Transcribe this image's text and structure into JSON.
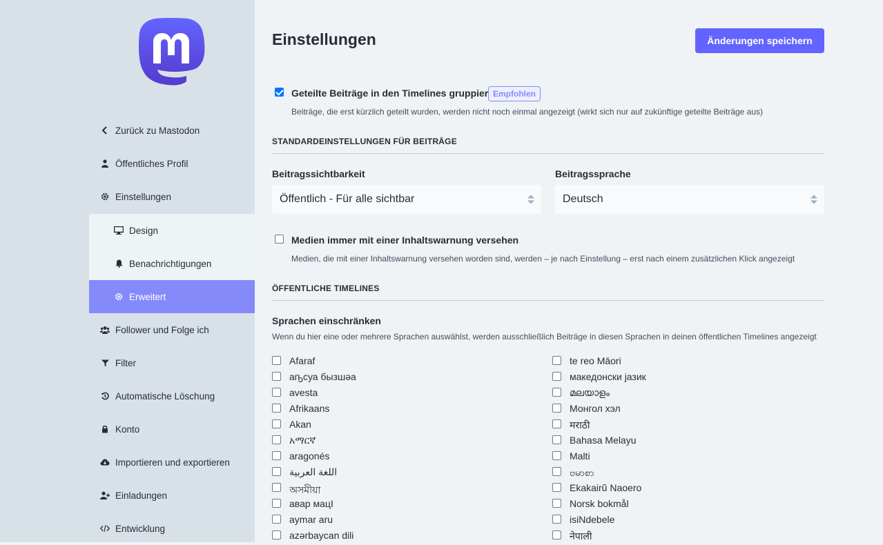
{
  "sidebar": {
    "logo": "mastodon-logo",
    "items": [
      {
        "label": "Zurück zu Mastodon",
        "icon": "chevron-left-icon"
      },
      {
        "label": "Öffentliches Profil",
        "icon": "user-icon"
      },
      {
        "label": "Einstellungen",
        "icon": "gear-icon"
      },
      {
        "label": "Design",
        "icon": "desktop-icon"
      },
      {
        "label": "Benachrichtigungen",
        "icon": "bell-icon"
      },
      {
        "label": "Erweitert",
        "icon": "gear-icon"
      },
      {
        "label": "Follower und Folge ich",
        "icon": "users-icon"
      },
      {
        "label": "Filter",
        "icon": "filter-icon"
      },
      {
        "label": "Automatische Löschung",
        "icon": "history-icon"
      },
      {
        "label": "Konto",
        "icon": "lock-icon"
      },
      {
        "label": "Importieren und exportieren",
        "icon": "cloud-download-icon"
      },
      {
        "label": "Einladungen",
        "icon": "user-plus-icon"
      },
      {
        "label": "Entwicklung",
        "icon": "code-icon"
      }
    ]
  },
  "header": {
    "title": "Einstellungen",
    "save_label": "Änderungen speichern"
  },
  "colors": {
    "accent": "#6364ff",
    "active_nav": "#858afa",
    "sidebar": "#d9e1e8",
    "main": "#eff3f5"
  },
  "group_reblogs": {
    "checked": true,
    "label": "Geteilte Beiträge in den Timelines gruppieren",
    "badge": "Empfohlen",
    "hint": "Beiträge, die erst kürzlich geteilt wurden, werden nicht noch einmal angezeigt (wirkt sich nur auf zukünftige geteilte Beiträge aus)"
  },
  "posting_defaults": {
    "section_title": "STANDARDEINSTELLUNGEN FÜR BEITRÄGE",
    "visibility_label": "Beitragssichtbarkeit",
    "visibility_value": "Öffentlich - Für alle sichtbar",
    "language_label": "Beitragssprache",
    "language_value": "Deutsch"
  },
  "sensitive": {
    "checked": false,
    "label": "Medien immer mit einer Inhaltswarnung versehen",
    "hint": "Medien, die mit einer Inhaltswarnung versehen worden sind, werden – je nach Einstellung – erst nach einem zusätzlichen Klick angezeigt"
  },
  "public_timelines": {
    "section_title": "ÖFFENTLICHE TIMELINES",
    "languages_label": "Sprachen einschränken",
    "languages_hint": "Wenn du hier eine oder mehrere Sprachen auswählst, werden ausschließlich Beiträge in diesen Sprachen in deinen öffentlichen Timelines angezeigt",
    "languages_left": [
      "Afaraf",
      "аҧсуа бызшәа",
      "avesta",
      "Afrikaans",
      "Akan",
      "አማርኛ",
      "aragonés",
      "اللغة العربية",
      "অসমীয়া",
      "авар мацӀ",
      "aymar aru",
      "azərbaycan dili"
    ],
    "languages_right": [
      "te reo Māori",
      "македонски јазик",
      "മലയാളം",
      "Монгол хэл",
      "मराठी",
      "Bahasa Melayu",
      "Malti",
      "ဗမာစာ",
      "Ekakairũ Naoero",
      "Norsk bokmål",
      "isiNdebele",
      "नेपाली"
    ]
  }
}
